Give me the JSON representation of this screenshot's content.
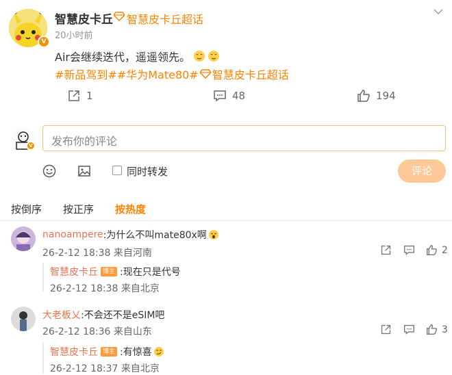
{
  "post": {
    "author": "智慧皮卡丘",
    "supertopic_label": "智慧皮卡丘超话",
    "time": "20小时前",
    "text": "Air会继续迭代，遥遥领先。",
    "hashtags": "#新品驾到##华为Mate80#",
    "hashtag_supertopic": "智慧皮卡丘超话",
    "badge_letter": "V",
    "actions": {
      "share_count": "1",
      "comment_count": "48",
      "like_count": "194"
    }
  },
  "composer": {
    "placeholder": "发布你的评论",
    "repost_label": "同时转发",
    "submit_label": "评论"
  },
  "sort": {
    "items": [
      "按倒序",
      "按正序",
      "按热度"
    ],
    "active_index": 2
  },
  "comments": [
    {
      "user": "nanoampere",
      "text": ":为什么不叫mate80x啊",
      "meta": "26-2-12 18:38 来自河南",
      "like_count": "2",
      "reply": {
        "user": "智慧皮卡丘",
        "tag": "博主",
        "text": ":现在只是代号",
        "meta": "26-2-12 18:38 来自北京"
      }
    },
    {
      "user": "大老板乂",
      "text": ":不会还不是eSIM吧",
      "meta": "26-2-12 18:36 来自山东",
      "like_count": "3",
      "reply": {
        "user": "智慧皮卡丘",
        "tag": "博主",
        "text": ":有惊喜",
        "meta": "26-2-12 18:37 来自北京"
      }
    }
  ],
  "colors": {
    "accent": "#ff8200",
    "username": "#eb7350",
    "submit_bg": "#ffc899",
    "input_border": "#f3c07a"
  }
}
